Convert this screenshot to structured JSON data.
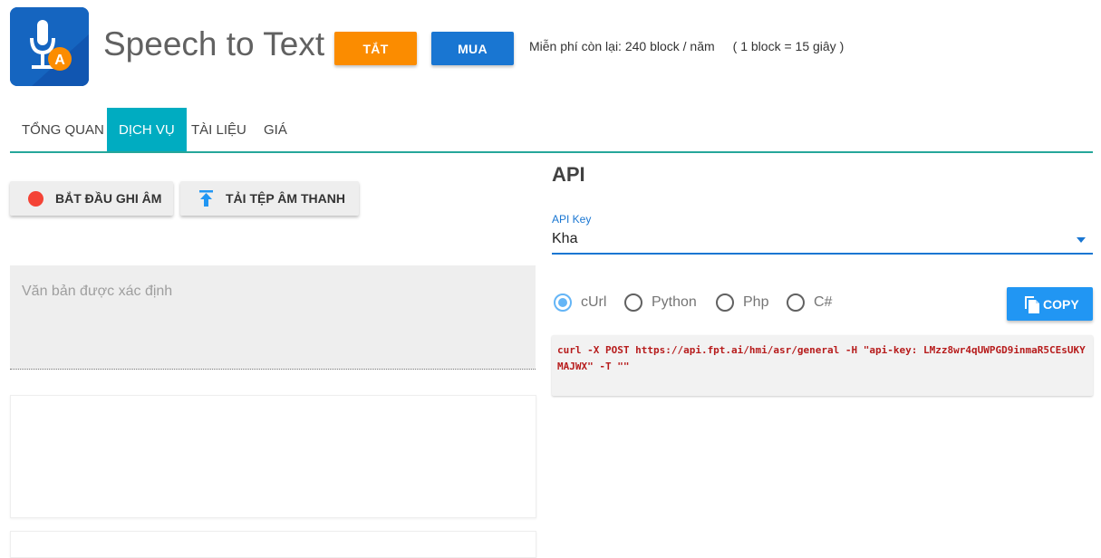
{
  "header": {
    "app_title": "Speech to Text",
    "logo_letter": "A",
    "off_button": "TẮT",
    "buy_button": "MUA",
    "free_remaining": "Miễn phí còn lại: 240 block / năm",
    "block_note": "( 1 block = 15 giây )"
  },
  "tabs": [
    {
      "label": "TỔNG QUAN",
      "active": false
    },
    {
      "label": "DỊCH VỤ",
      "active": true
    },
    {
      "label": "TÀI LIỆU",
      "active": false
    },
    {
      "label": "GIÁ",
      "active": false
    }
  ],
  "left": {
    "record_button": "BẮT ĐẦU GHI ÂM",
    "upload_button": "TẢI TỆP ÂM THANH",
    "result_placeholder": "Văn bản được xác định"
  },
  "api": {
    "title": "API",
    "key_label": "API Key",
    "key_value": "Kha",
    "languages": [
      {
        "label": "cUrl",
        "checked": true
      },
      {
        "label": "Python",
        "checked": false
      },
      {
        "label": "Php",
        "checked": false
      },
      {
        "label": "C#",
        "checked": false
      }
    ],
    "copy_button": "COPY",
    "code": "curl -X POST https://api.fpt.ai/hmi/asr/general -H \"api-key: LMzz8wr4qUWPGD9inmaR5CEsUKYMAJWX\" -T \"\""
  },
  "colors": {
    "accent_teal": "#00acc1",
    "orange": "#fb8c00",
    "blue": "#1976d2",
    "record_red": "#f44336"
  },
  "icons": {
    "logo": "microphone-letter-a-icon",
    "record": "record-dot-icon",
    "upload": "upload-arrow-icon",
    "copy": "copy-icon",
    "dropdown": "caret-down-icon"
  }
}
